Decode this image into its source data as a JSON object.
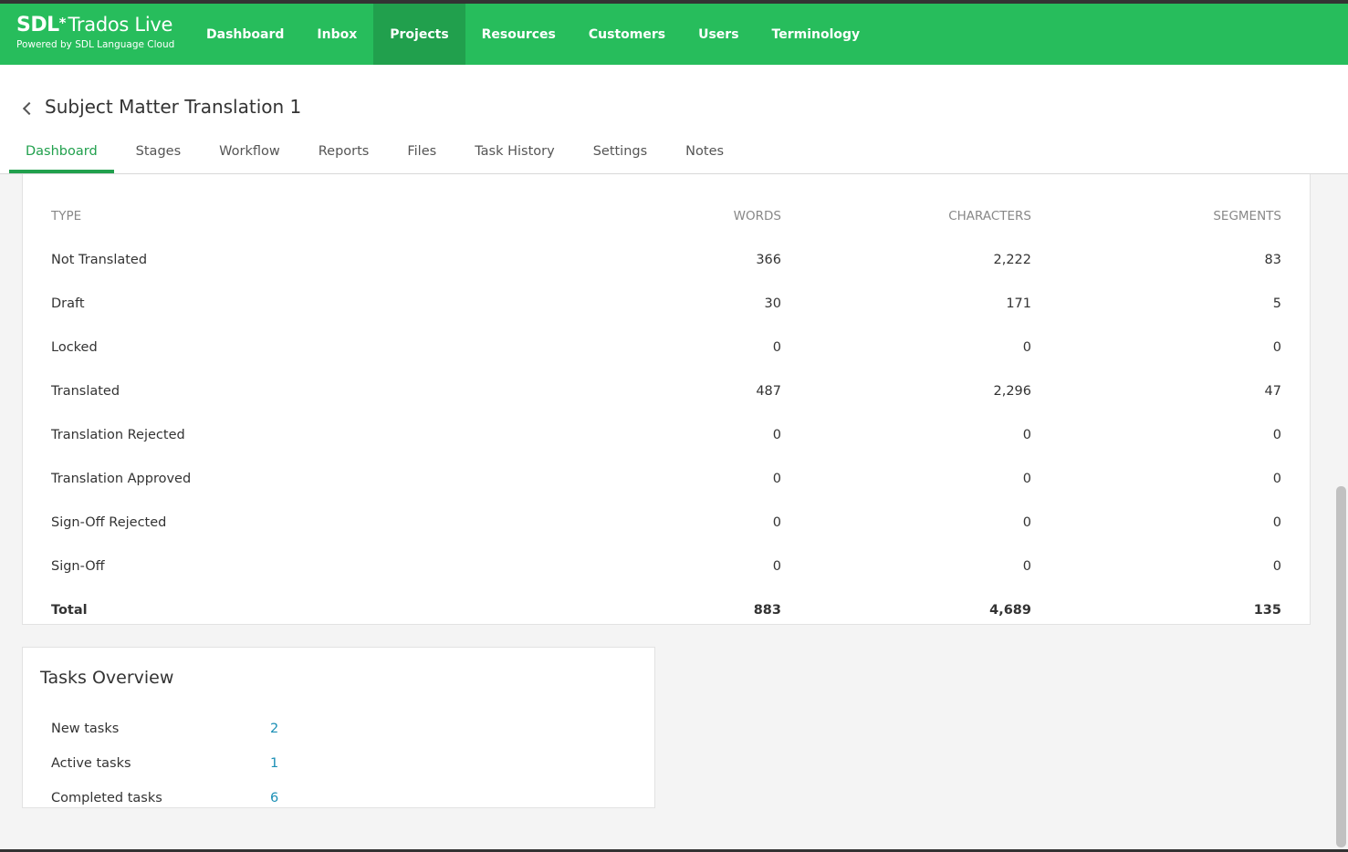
{
  "brand": {
    "name_bold": "SDL",
    "star": "*",
    "name_light": "Trados Live",
    "tagline": "Powered by SDL Language Cloud"
  },
  "nav": {
    "items": [
      {
        "label": "Dashboard"
      },
      {
        "label": "Inbox"
      },
      {
        "label": "Projects"
      },
      {
        "label": "Resources"
      },
      {
        "label": "Customers"
      },
      {
        "label": "Users"
      },
      {
        "label": "Terminology"
      }
    ],
    "active": "Projects"
  },
  "page": {
    "title": "Subject Matter Translation 1",
    "tabs": [
      {
        "label": "Dashboard"
      },
      {
        "label": "Stages"
      },
      {
        "label": "Workflow"
      },
      {
        "label": "Reports"
      },
      {
        "label": "Files"
      },
      {
        "label": "Task History"
      },
      {
        "label": "Settings"
      },
      {
        "label": "Notes"
      }
    ],
    "active_tab": "Dashboard"
  },
  "stats_table": {
    "headers": [
      "TYPE",
      "WORDS",
      "CHARACTERS",
      "SEGMENTS"
    ],
    "rows": [
      [
        "Not Translated",
        "366",
        "2,222",
        "83"
      ],
      [
        "Draft",
        "30",
        "171",
        "5"
      ],
      [
        "Locked",
        "0",
        "0",
        "0"
      ],
      [
        "Translated",
        "487",
        "2,296",
        "47"
      ],
      [
        "Translation Rejected",
        "0",
        "0",
        "0"
      ],
      [
        "Translation Approved",
        "0",
        "0",
        "0"
      ],
      [
        "Sign-Off Rejected",
        "0",
        "0",
        "0"
      ],
      [
        "Sign-Off",
        "0",
        "0",
        "0"
      ]
    ],
    "total": [
      "Total",
      "883",
      "4,689",
      "135"
    ]
  },
  "tasks_overview": {
    "title": "Tasks Overview",
    "items": [
      {
        "label": "New tasks",
        "value": "2"
      },
      {
        "label": "Active tasks",
        "value": "1"
      },
      {
        "label": "Completed tasks",
        "value": "6"
      }
    ]
  },
  "colors": {
    "brand_green": "#27bd5c",
    "active_nav": "#21a04d",
    "link_blue": "#1a8fb5"
  }
}
